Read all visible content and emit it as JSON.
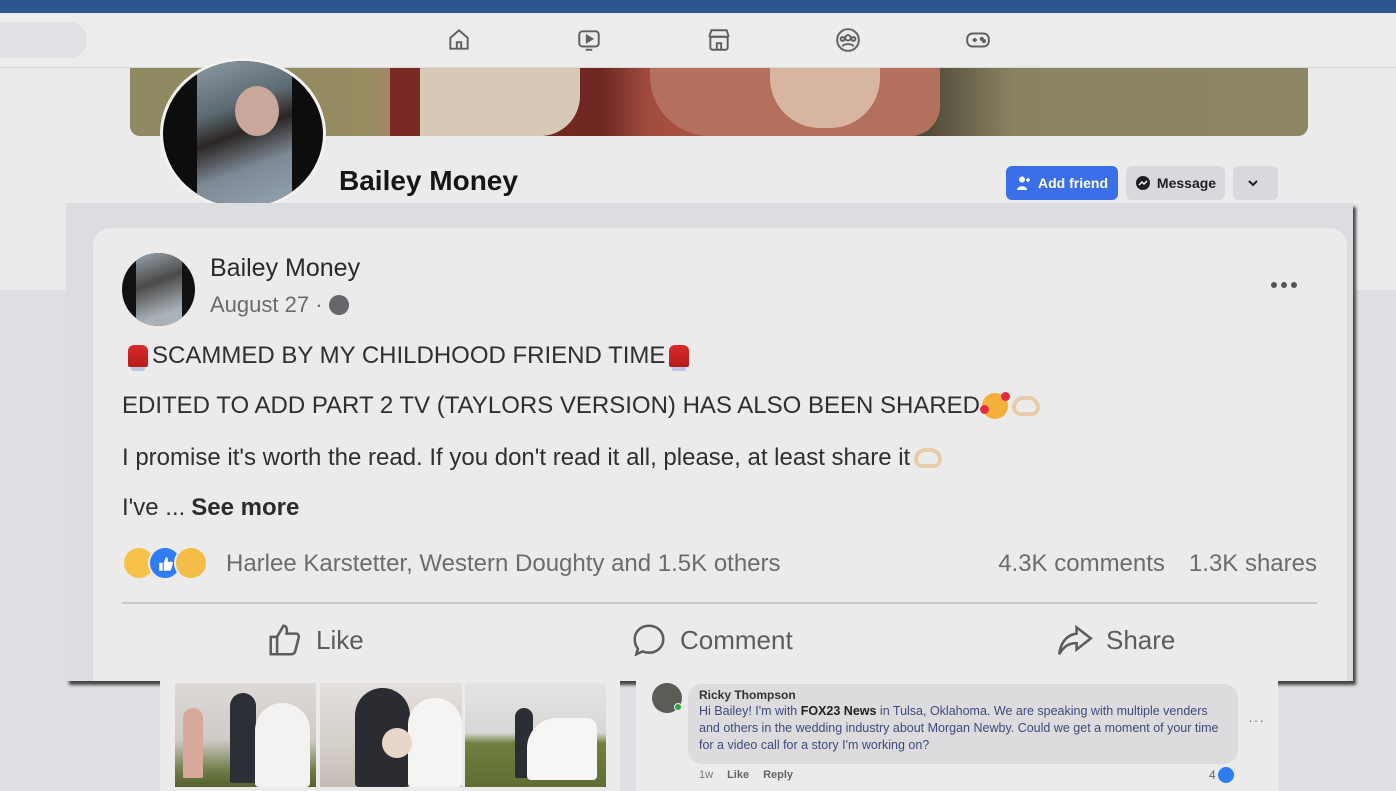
{
  "navbar": {
    "icons": [
      "home-icon",
      "watch-icon",
      "marketplace-icon",
      "groups-icon",
      "gaming-icon"
    ]
  },
  "profile": {
    "name": "Bailey Money",
    "buttons": {
      "add_friend": "Add friend",
      "message": "Message",
      "more": "⌄"
    }
  },
  "post": {
    "author": "Bailey Money",
    "date": "August 27 ·",
    "audience_icon": "globe-icon",
    "lines": [
      "SCAMMED BY MY CHILDHOOD FRIEND TIME",
      "EDITED TO ADD PART 2 TV (TAYLORS VERSION) HAS ALSO BEEN SHARED",
      "I promise it's worth the read. If you don't read it all, please, at least share it",
      "I've ..."
    ],
    "see_more": "See more",
    "reactions": [
      "wow",
      "like",
      "sad"
    ],
    "reaction_names": "Harlee Karstetter, Western Doughty and 1.5K others",
    "comments_count": "4.3K comments",
    "shares_count": "1.3K shares",
    "actions": {
      "like": "Like",
      "comment": "Comment",
      "share": "Share"
    }
  },
  "comment": {
    "author": "Ricky Thompson",
    "text_before": "Hi Bailey! I'm with ",
    "text_bold": "FOX23 News",
    "text_after": " in Tulsa, Oklahoma. We are speaking with multiple venders and others in the wedding industry about Morgan Newby. Could we get a moment of your time for a video call for a story I'm working on?",
    "time": "1w",
    "like": "Like",
    "reply": "Reply",
    "like_count": "4",
    "more": "···"
  },
  "colors": {
    "brand_blue": "#3a6fe8",
    "top_strip": "#2e5590"
  }
}
